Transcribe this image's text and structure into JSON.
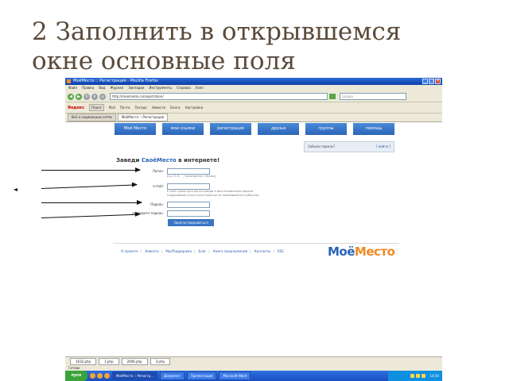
{
  "slide": {
    "title_line1": "2 Заполнить в открывшемся",
    "title_line2": "окне основные поля"
  },
  "browser": {
    "window_title": "МоёМесто :: Регистрация - Mozilla Firefox",
    "menu": [
      "Файл",
      "Правка",
      "Вид",
      "Журнал",
      "Закладки",
      "Инструменты",
      "Справка",
      "Хэлп"
    ],
    "url": "http://moemesto.ru/registration/",
    "search_placeholder": "Google",
    "toolbar": {
      "yandex": "Яндекс",
      "search_label": "Поиск",
      "items": [
        "Mail",
        "Почта",
        "Погода",
        "Новости",
        "Блоги",
        "Настройки"
      ]
    },
    "tabs": [
      {
        "label": "Всё о социальных сетях",
        "active": false
      },
      {
        "label": "МоёМесто :: Регистрация",
        "active": true
      }
    ]
  },
  "site": {
    "nav": [
      "Моё Место",
      "мои ссылки",
      "регистрация",
      "друзья",
      "группы",
      "помощь"
    ],
    "forgot_password": "Забыли пароль?",
    "enter_link": "[ войти ]",
    "heading_prefix": "Заведи ",
    "heading_brand": "СвоёМесто",
    "heading_suffix": " в интернете!",
    "form": {
      "login_label": "Логин:",
      "login_hint": "[a-z, 0-9, _ , начинается с буквы]",
      "email_label": "e-mail:",
      "email_hint_1": "E-mail нужен для регистрации и восстановления пароля.",
      "email_hint_2": "Содержимое этого поля никогда не показывается публично.",
      "password_label": "Пароль:",
      "password_repeat_label": "повторите пароль:",
      "submit": "Зарегистрироваться"
    },
    "footer": [
      "О проекте",
      "Новости",
      "Мы/Поддержка",
      "Блог",
      "Книга предложений",
      "Контакты",
      "RSS"
    ],
    "logo_part1": "Моё",
    "logo_part2": "Место"
  },
  "downloads": [
    "1632.php",
    "1.php",
    "2006.php",
    "3.php"
  ],
  "status": "Готово",
  "taskbar": {
    "start": "пуск",
    "buttons": [
      {
        "label": "МоёМесто :: Регистр...",
        "active": true
      },
      {
        "label": "Документ",
        "active": false
      },
      {
        "label": "Презентация",
        "active": false
      },
      {
        "label": "Microsoft Word",
        "active": false
      }
    ],
    "clock": "14:50"
  },
  "colors": {
    "title": "#5a4a3a",
    "site_blue": "#2a64b8",
    "logo_orange": "#f08a24"
  }
}
